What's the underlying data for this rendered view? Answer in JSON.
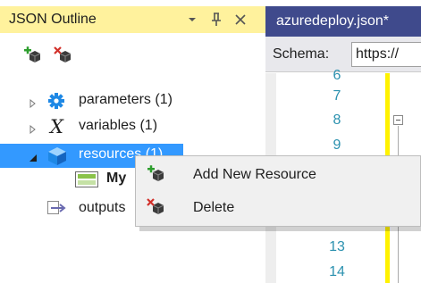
{
  "outline": {
    "title": "JSON Outline",
    "header_buttons": {
      "dropdown": "▾",
      "pin": "ꟸ",
      "close": "✕"
    },
    "tree": [
      {
        "label": "parameters (1)",
        "icon": "gear-icon"
      },
      {
        "label": "variables (1)",
        "icon": "variable-x-icon"
      },
      {
        "label": "resources (1)",
        "icon": "cube-icon",
        "selected": true
      },
      {
        "label": "My",
        "icon": "resource-icon"
      },
      {
        "label": "outputs",
        "icon": "outputs-icon"
      }
    ]
  },
  "editor": {
    "tab_title": "azuredeploy.json*",
    "schema_label": "Schema:",
    "schema_value": "https://",
    "line_numbers": [
      "6",
      "7",
      "8",
      "9",
      "",
      "",
      "",
      "13",
      "14"
    ]
  },
  "context_menu": {
    "items": [
      {
        "label": "Add New Resource",
        "icon": "add-resource-icon"
      },
      {
        "label": "Delete",
        "icon": "delete-resource-icon"
      }
    ]
  },
  "colors": {
    "header_bg": "#fff29d",
    "tab_bg": "#3f4a8c",
    "selection": "#3399ff",
    "line_number": "#2b91af"
  }
}
